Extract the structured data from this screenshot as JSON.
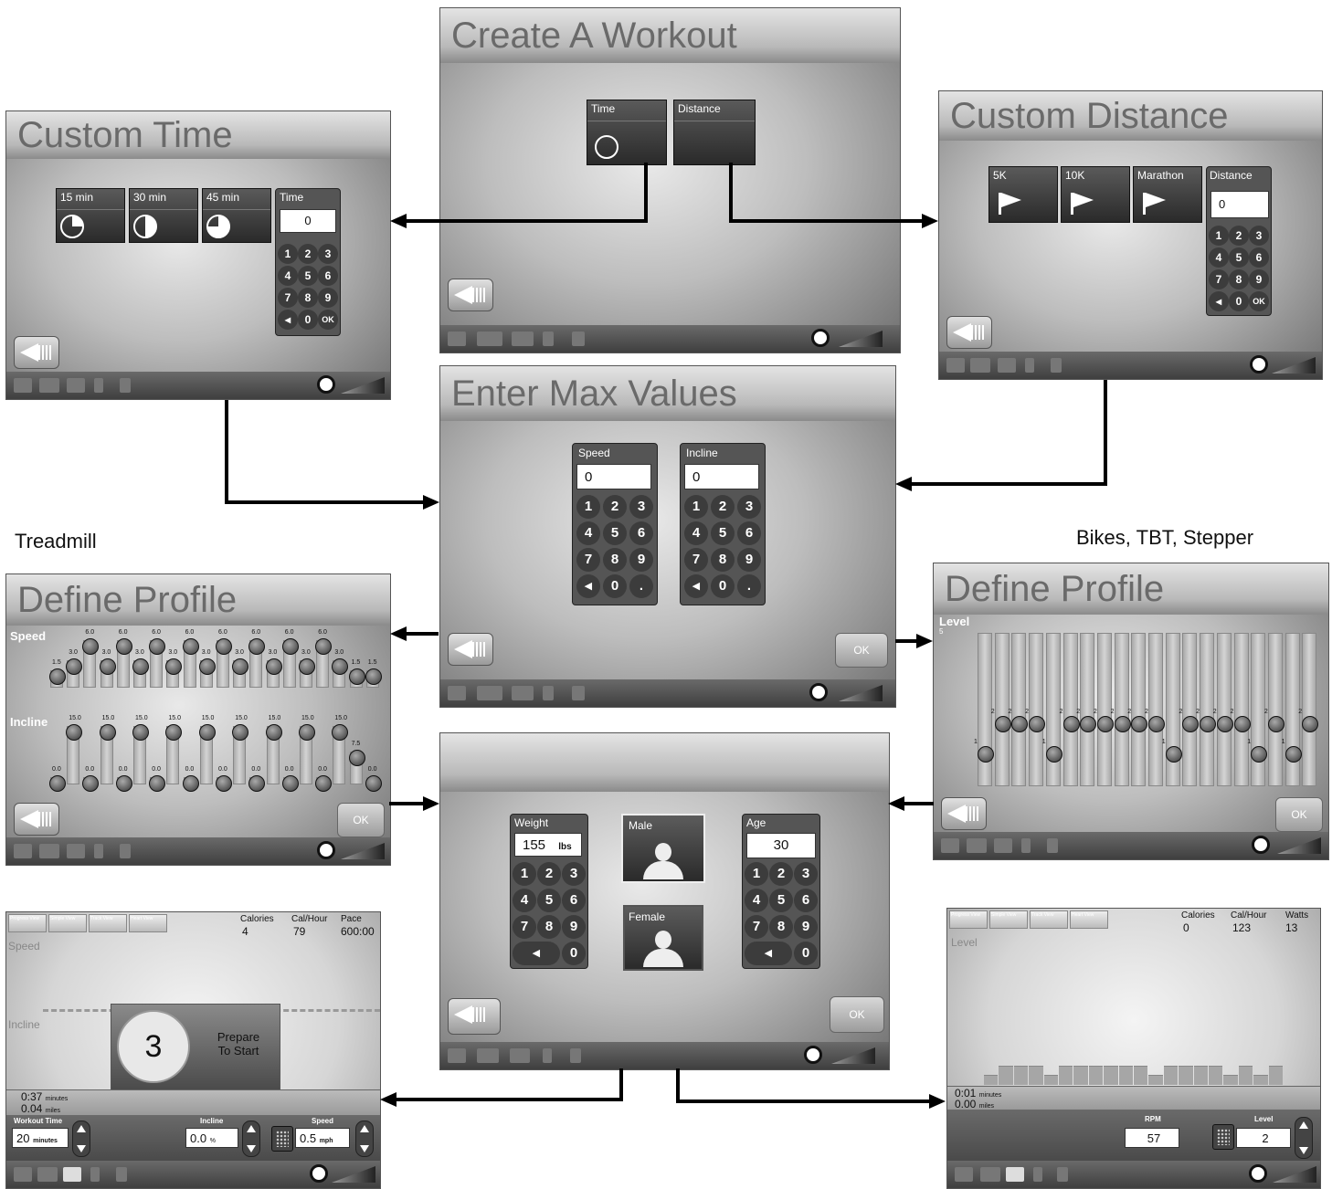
{
  "captions": {
    "treadmill": "Treadmill",
    "bikes": "Bikes, TBT, Stepper"
  },
  "create_workout": {
    "title": "Create A Workout",
    "time_tile": "Time",
    "distance_tile": "Distance"
  },
  "custom_time": {
    "title": "Custom Time",
    "tiles": [
      "15 min",
      "30 min",
      "45 min"
    ],
    "input_label": "Time",
    "input_value": "0",
    "keys": [
      "1",
      "2",
      "3",
      "4",
      "5",
      "6",
      "7",
      "8",
      "9",
      "0",
      "OK"
    ]
  },
  "custom_distance": {
    "title": "Custom Distance",
    "tiles": [
      "5K",
      "10K",
      "Marathon"
    ],
    "input_label": "Distance",
    "input_value": "0",
    "keys": [
      "1",
      "2",
      "3",
      "4",
      "5",
      "6",
      "7",
      "8",
      "9",
      "0",
      "OK"
    ]
  },
  "max_values": {
    "title": "Enter Max Values",
    "speed_label": "Speed",
    "speed_value": "0",
    "incline_label": "Incline",
    "incline_value": "0",
    "keys": [
      "1",
      "2",
      "3",
      "4",
      "5",
      "6",
      "7",
      "8",
      "9",
      "0",
      "."
    ],
    "ok": "OK"
  },
  "define_profile_treadmill": {
    "title": "Define Profile",
    "speed_label": "Speed",
    "incline_label": "Incline",
    "ok": "OK",
    "speed_values": [
      1.5,
      3.0,
      6.0,
      3.0,
      6.0,
      3.0,
      6.0,
      3.0,
      6.0,
      3.0,
      6.0,
      3.0,
      6.0,
      3.0,
      6.0,
      3.0,
      6.0,
      3.0,
      1.5,
      1.5
    ],
    "incline_values": [
      0.0,
      15.0,
      0.0,
      15.0,
      0.0,
      15.0,
      0.0,
      15.0,
      0.0,
      15.0,
      0.0,
      15.0,
      0.0,
      15.0,
      0.0,
      15.0,
      0.0,
      15.0,
      7.5,
      0.0
    ]
  },
  "define_profile_bike": {
    "title": "Define Profile",
    "level_label": "Level",
    "level_max": "5",
    "ok": "OK",
    "level_values": [
      1,
      2,
      2,
      2,
      1,
      2,
      2,
      2,
      2,
      2,
      2,
      1,
      2,
      2,
      2,
      2,
      1,
      2,
      1,
      2
    ]
  },
  "user_info": {
    "weight_label": "Weight",
    "weight_value": "155",
    "weight_unit": "lbs",
    "male": "Male",
    "female": "Female",
    "age_label": "Age",
    "age_value": "30",
    "keys": [
      "1",
      "2",
      "3",
      "4",
      "5",
      "6",
      "7",
      "8",
      "9",
      "0"
    ],
    "ok": "OK"
  },
  "workout_treadmill": {
    "tabs": [
      "Progress View",
      "Simple View",
      "Track View",
      "Heart View"
    ],
    "calories_label": "Calories",
    "calories_value": "4",
    "calhour_label": "Cal/Hour",
    "calhour_value": "79",
    "pace_label": "Pace",
    "pace_value": "600:00",
    "speed_label": "Speed",
    "incline_label": "Incline",
    "countdown": "3",
    "prepare": "Prepare\nTo Start",
    "time_value": "0:37",
    "time_unit": "minutes",
    "dist_value": "0.04",
    "dist_unit": "miles",
    "workout_time_label": "Workout Time",
    "workout_time_value": "20",
    "workout_time_unit": "minutes",
    "incline_ctrl_label": "Incline",
    "incline_ctrl_value": "0.0",
    "incline_ctrl_unit": "%",
    "speed_ctrl_label": "Speed",
    "speed_ctrl_value": "0.5",
    "speed_ctrl_unit": "mph"
  },
  "workout_bike": {
    "tabs": [
      "Progress View",
      "Simple View",
      "Track View",
      "Heart View"
    ],
    "calories_label": "Calories",
    "calories_value": "0",
    "calhour_label": "Cal/Hour",
    "calhour_value": "123",
    "watts_label": "Watts",
    "watts_value": "13",
    "level_label": "Level",
    "time_value": "0:01",
    "time_unit": "minutes",
    "dist_value": "0.00",
    "dist_unit": "miles",
    "rpm_label": "RPM",
    "rpm_value": "57",
    "level_ctrl_label": "Level",
    "level_ctrl_value": "2"
  }
}
